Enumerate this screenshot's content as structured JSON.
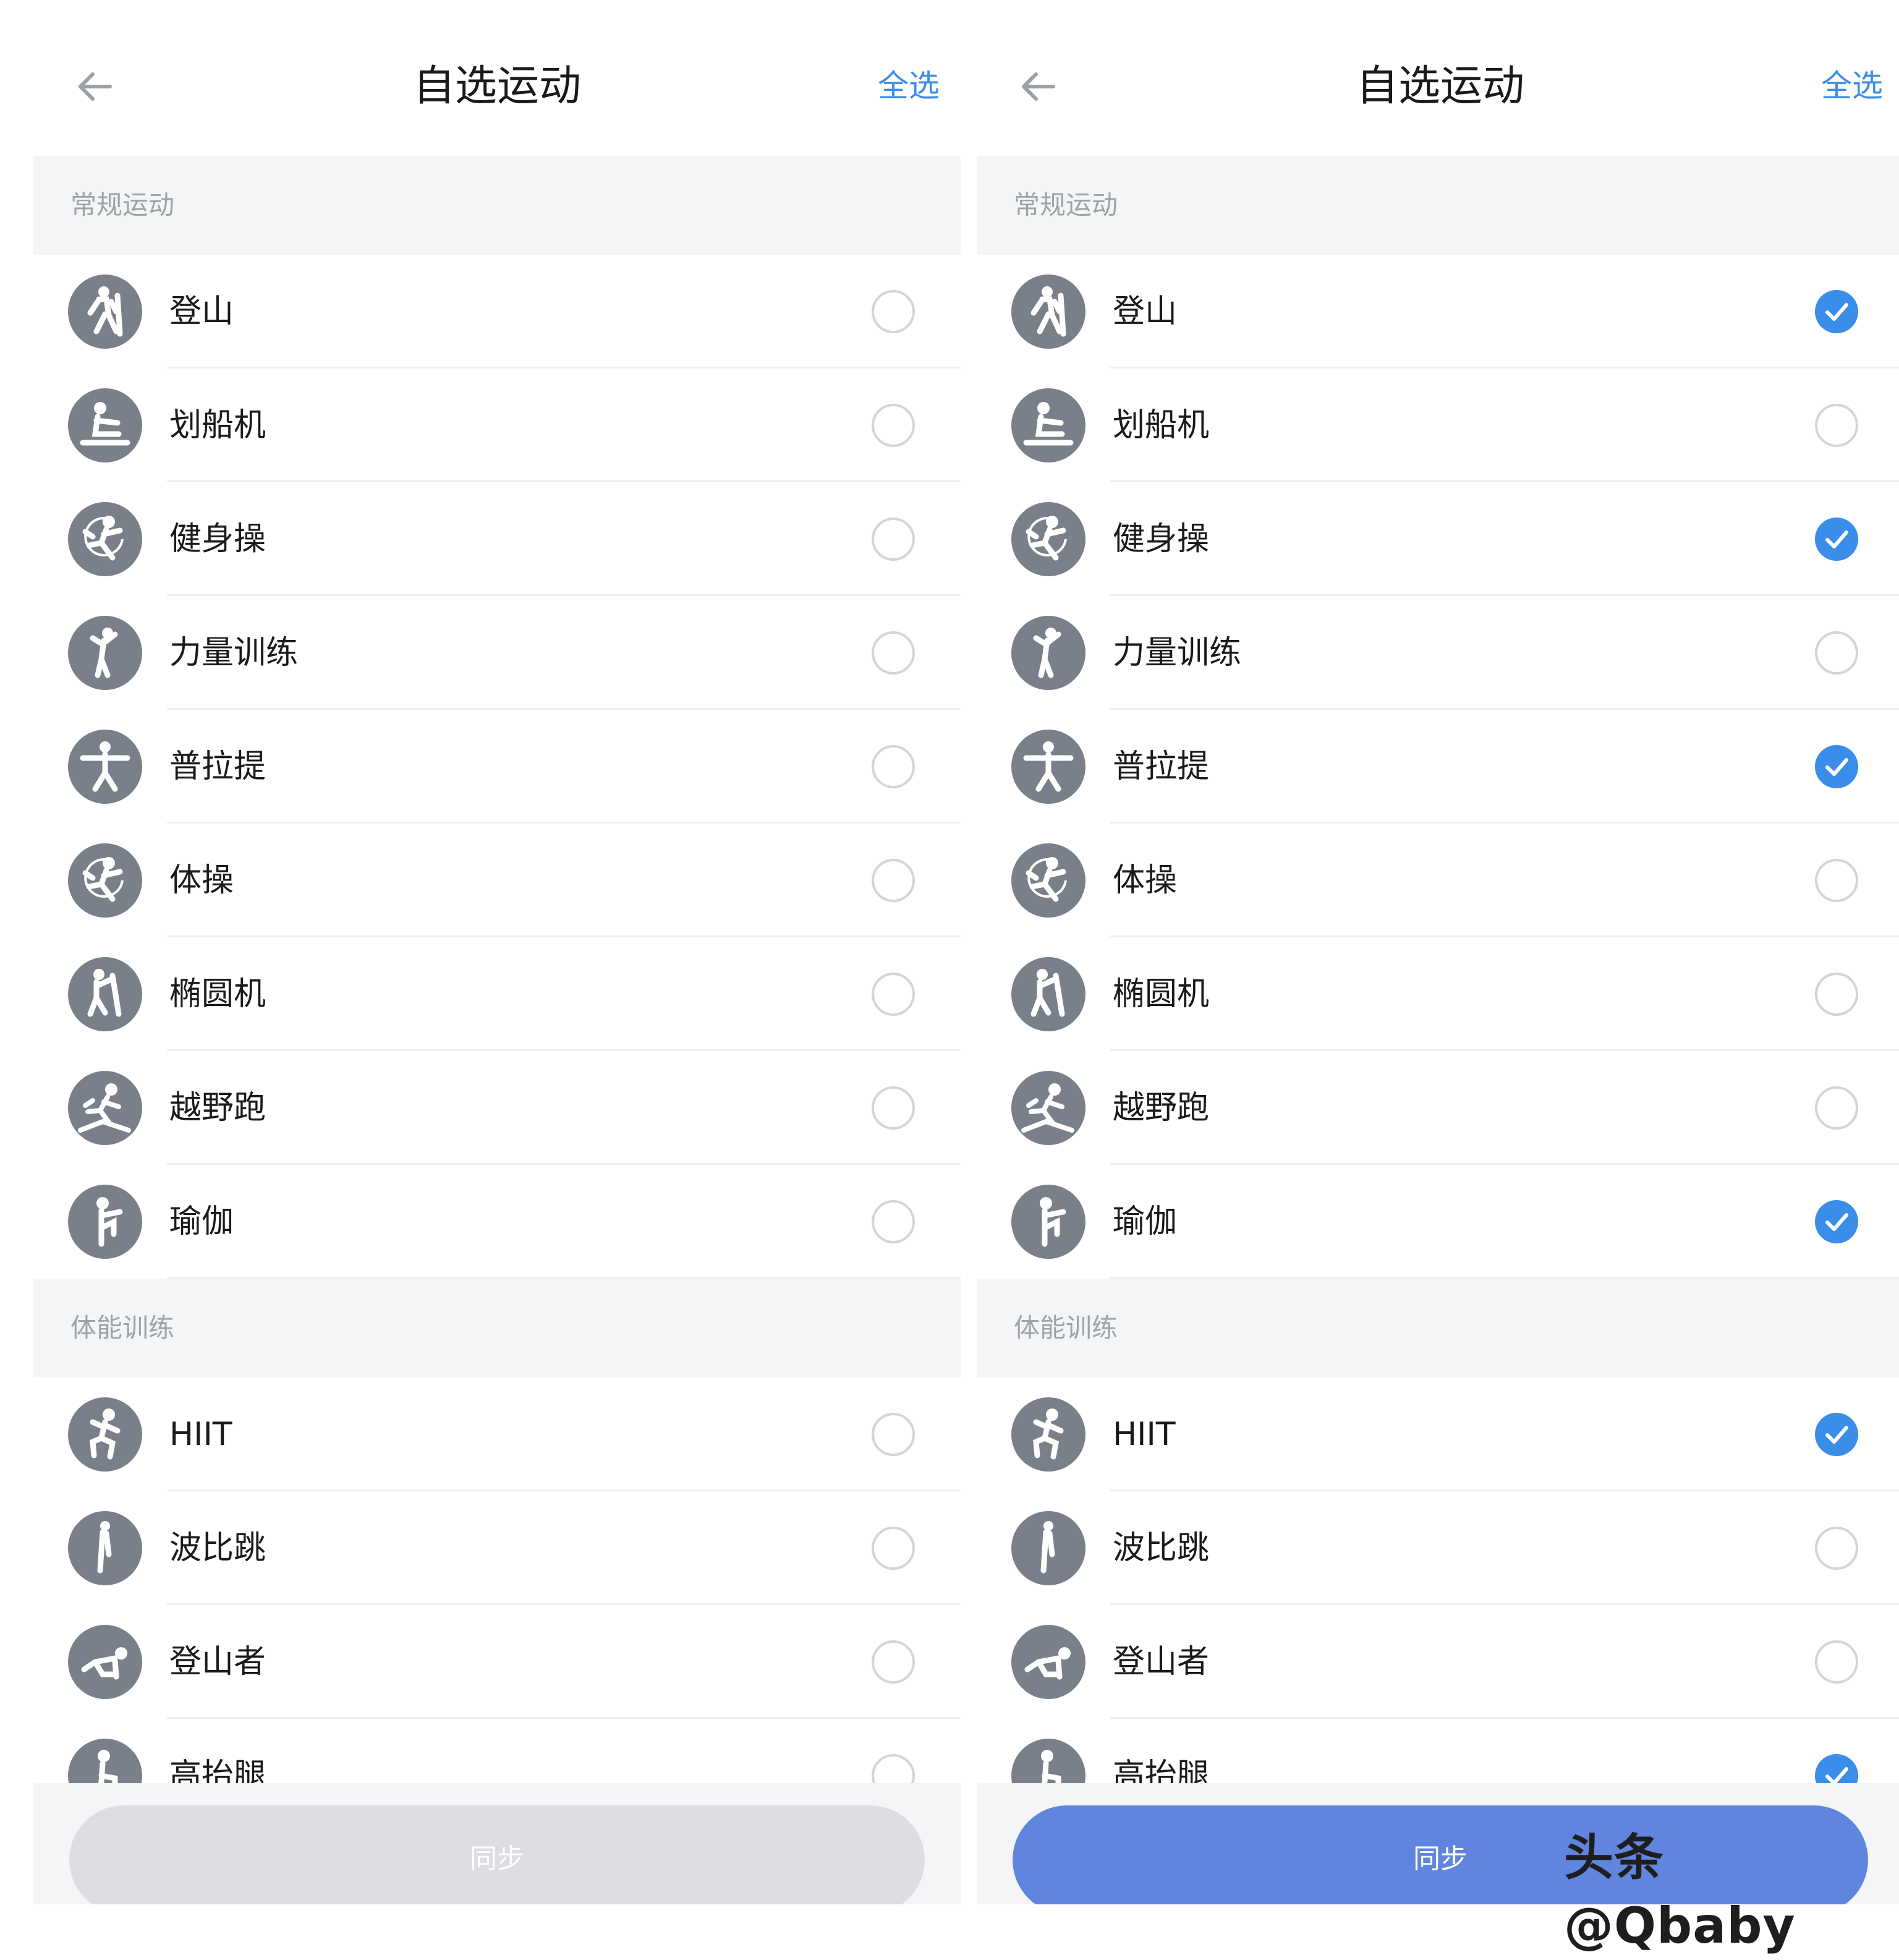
{
  "header": {
    "title": "自选运动",
    "select_all_label": "全选"
  },
  "sections": [
    {
      "title": "常规运动"
    },
    {
      "title": "体能训练"
    }
  ],
  "items": [
    {
      "label": "登山",
      "icon": "hiking-icon"
    },
    {
      "label": "划船机",
      "icon": "rowing-machine-icon"
    },
    {
      "label": "健身操",
      "icon": "aerobics-icon"
    },
    {
      "label": "力量训练",
      "icon": "strength-training-icon"
    },
    {
      "label": "普拉提",
      "icon": "pilates-icon"
    },
    {
      "label": "体操",
      "icon": "gymnastics-icon"
    },
    {
      "label": "椭圆机",
      "icon": "elliptical-icon"
    },
    {
      "label": "越野跑",
      "icon": "trail-running-icon"
    },
    {
      "label": "瑜伽",
      "icon": "yoga-icon"
    },
    {
      "label": "HIIT",
      "icon": "hiit-icon"
    },
    {
      "label": "波比跳",
      "icon": "burpee-icon"
    },
    {
      "label": "登山者",
      "icon": "mountain-climber-icon"
    },
    {
      "label": "高抬腿",
      "icon": "high-knees-icon"
    }
  ],
  "left_checked": [
    false,
    false,
    false,
    false,
    false,
    false,
    false,
    false,
    false,
    false,
    false,
    false,
    false
  ],
  "right_checked": [
    true,
    false,
    true,
    false,
    true,
    false,
    false,
    false,
    true,
    true,
    false,
    false,
    true
  ],
  "footer": {
    "sync_label": "同步"
  },
  "colors": {
    "accent": "#3a8eea",
    "sync_active": "#6085df",
    "sync_disabled": "#dcdee2",
    "icon_bg": "#7a808a"
  },
  "watermark": "头条 @Qbaby"
}
